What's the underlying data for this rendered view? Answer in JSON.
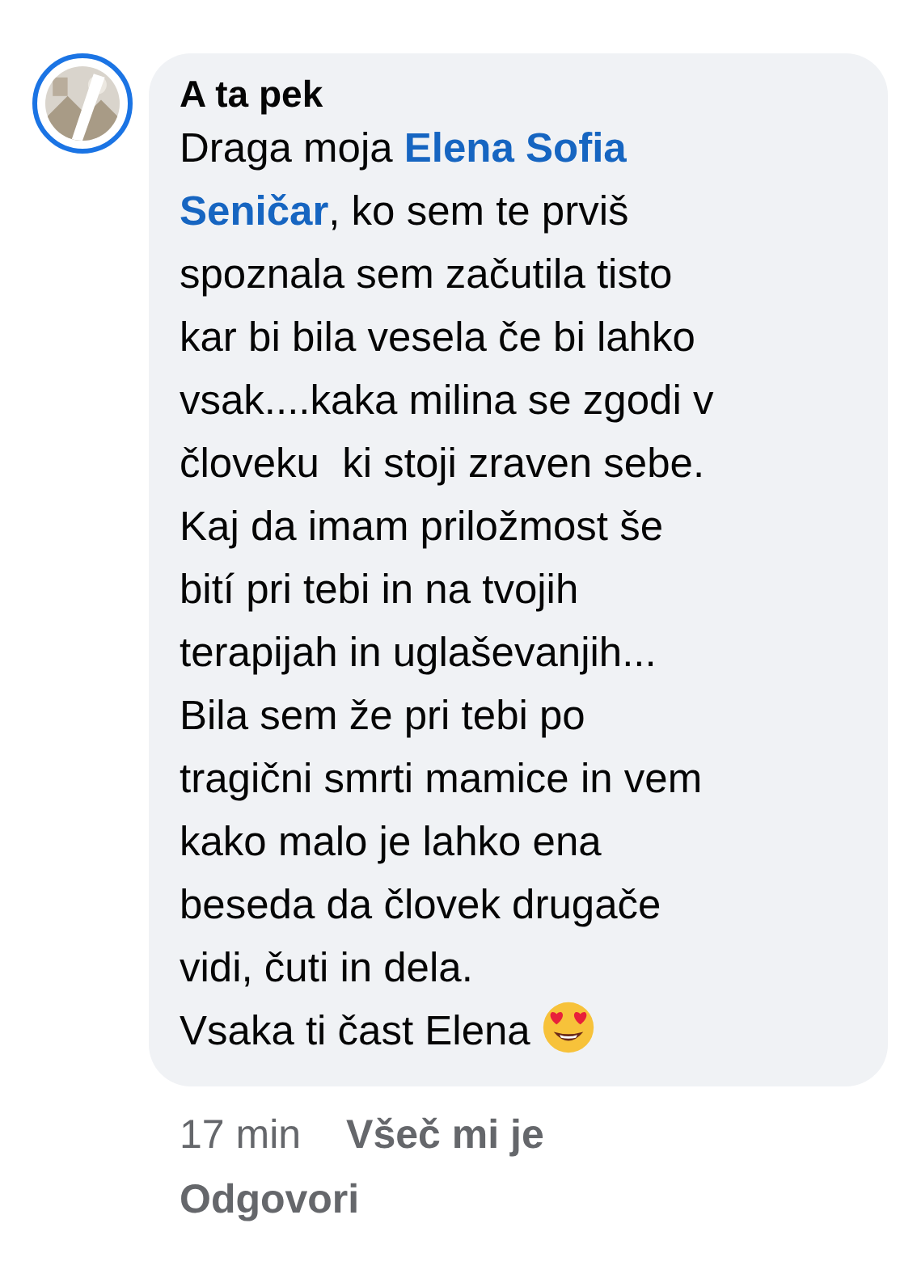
{
  "comment": {
    "author": "A  ta   pek",
    "has_story_ring": true,
    "body": [
      {
        "kind": "text",
        "text": "Draga moja "
      },
      {
        "kind": "mention",
        "text": "Elena Sofia"
      },
      {
        "kind": "break"
      },
      {
        "kind": "mention",
        "text": "Seničar"
      },
      {
        "kind": "text",
        "text": ", ko sem te prviš\nspoznala sem začutila tisto\nkar bi bila vesela če bi lahko\nvsak....kaka milina se zgodi v\nčloveku  ki stoji zraven sebe.\nKaj da imam priložmost še\nbití pri tebi in na tvojih\nterapijah in uglaševanjih...\nBila sem že pri tebi po\ntragični smrti mamice in vem\nkako malo je lahko ena\nbeseda da človek drugače\nvidi, čuti in dela.\nVsaka ti čast Elena "
      }
    ],
    "time": "17 min",
    "actions": [
      "Všeč mi je",
      "Odgovori"
    ]
  }
}
